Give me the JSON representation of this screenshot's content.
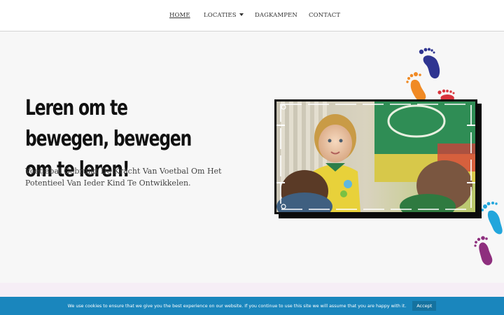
{
  "nav": {
    "items": [
      {
        "label": "HOME",
        "active": true
      },
      {
        "label": "LOCATIES",
        "dropdown": true
      },
      {
        "label": "DAGKAMPEN"
      },
      {
        "label": "CONTACT"
      }
    ]
  },
  "hero": {
    "headline_line1": "Leren om te bewegen, bewegen",
    "headline_line2": "om te leren!",
    "subtext": "Voetjebal Gebruikt De Kracht Van Voetbal Om Het Potentieel Van Ieder Kind Te Ontwikkelen."
  },
  "cookie": {
    "text": "We use cookies to ensure that we give you the best experience on our website. If you continue to use this site we will assume that you are happy with it.",
    "accept_label": "Accept"
  },
  "colors": {
    "footprint_navy": "#2f3591",
    "footprint_orange": "#f08a24",
    "footprint_red": "#d9343c",
    "footprint_blue": "#22a6dc",
    "footprint_purple": "#8e2f7e",
    "cookie_bar": "#1a86bd"
  }
}
